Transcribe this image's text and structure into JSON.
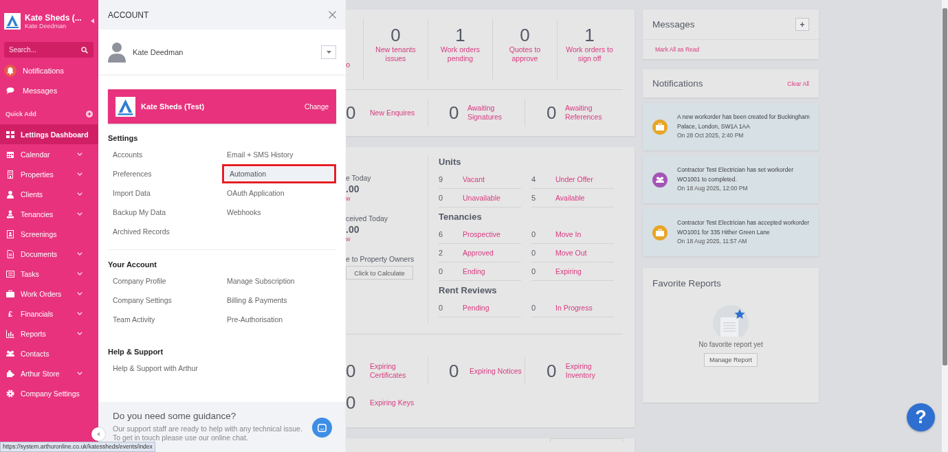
{
  "sidebar": {
    "company": "Kate Sheds (...",
    "user": "Kate Deedman",
    "search": {
      "placeholder": "Search..."
    },
    "top_items": [
      {
        "label": "Notifications",
        "kind": "bell"
      },
      {
        "label": "Messages",
        "kind": "chat"
      }
    ],
    "quick_add": "Quick Add",
    "nav": [
      {
        "label": "Lettings Dashboard",
        "kind": "grid",
        "expandable": false,
        "selected": true
      },
      {
        "label": "Calendar",
        "kind": "calendar",
        "expandable": true,
        "selected": false
      },
      {
        "label": "Properties",
        "kind": "building",
        "expandable": true,
        "selected": false
      },
      {
        "label": "Clients",
        "kind": "person",
        "expandable": true,
        "selected": false
      },
      {
        "label": "Tenancies",
        "kind": "tenancy",
        "expandable": true,
        "selected": false
      },
      {
        "label": "Screenings",
        "kind": "idcard",
        "expandable": false,
        "selected": false
      },
      {
        "label": "Documents",
        "kind": "document",
        "expandable": true,
        "selected": false
      },
      {
        "label": "Tasks",
        "kind": "list",
        "expandable": true,
        "selected": false
      },
      {
        "label": "Work Orders",
        "kind": "briefcase",
        "expandable": true,
        "selected": false
      },
      {
        "label": "Financials",
        "kind": "glyph",
        "glyph": "£",
        "expandable": true,
        "selected": false
      },
      {
        "label": "Reports",
        "kind": "chart",
        "expandable": true,
        "selected": false
      },
      {
        "label": "Contacts",
        "kind": "people",
        "expandable": false,
        "selected": false
      },
      {
        "label": "Arthur Store",
        "kind": "puzzle",
        "expandable": true,
        "selected": false
      },
      {
        "label": "Company Settings",
        "kind": "gear",
        "expandable": false,
        "selected": false
      }
    ]
  },
  "account_panel": {
    "title": "ACCOUNT",
    "user": "Kate Deedman",
    "company": {
      "name": "Kate Sheds (Test)",
      "action": "Change"
    },
    "sections": [
      {
        "heading": "Settings",
        "links": [
          {
            "label": "Accounts",
            "selected": false
          },
          {
            "label": "Email + SMS History",
            "selected": false
          },
          {
            "label": "Preferences",
            "selected": false
          },
          {
            "label": "Automation",
            "selected": true
          },
          {
            "label": "Import Data",
            "selected": false
          },
          {
            "label": "OAuth Application",
            "selected": false
          },
          {
            "label": "Backup My Data",
            "selected": false
          },
          {
            "label": "Webhooks",
            "selected": false
          },
          {
            "label": "Archived Records",
            "selected": false
          }
        ]
      },
      {
        "heading": "Your Account",
        "links": [
          {
            "label": "Company Profile",
            "selected": false
          },
          {
            "label": "Manage Subscription",
            "selected": false
          },
          {
            "label": "Company Settings",
            "selected": false
          },
          {
            "label": "Billing & Payments",
            "selected": false
          },
          {
            "label": "Team Activity",
            "selected": false
          },
          {
            "label": "Pre-Authorisation",
            "selected": false
          }
        ]
      },
      {
        "heading": "Help & Support",
        "links": [
          {
            "label": "Help & Support with Arthur",
            "selected": false
          }
        ]
      }
    ],
    "guidance": {
      "title": "Do you need some guidance?",
      "text": "Our support staff are ready to help with any technical issue. To get in touch please use our online chat."
    }
  },
  "dashboard": {
    "summary": {
      "fragment": "o",
      "stats": [
        {
          "value": "0",
          "label": "New tenants issues"
        },
        {
          "value": "1",
          "label": "Work orders pending"
        },
        {
          "value": "0",
          "label": "Quotes to approve"
        },
        {
          "value": "1",
          "label": "Work orders to sign off"
        }
      ],
      "row_2": [
        {
          "value": "0",
          "label": "New Enquires"
        },
        {
          "value": "0",
          "label": "Awaiting Signatures"
        },
        {
          "value": "0",
          "label": "Awaiting References"
        }
      ]
    },
    "finance": {
      "fragments": [
        {
          "kind": "caption",
          "text": "e Today"
        },
        {
          "kind": "amount",
          "text": ".00"
        },
        {
          "kind": "link",
          "text": "w"
        },
        {
          "kind": "caption",
          "text": "ceived Today"
        },
        {
          "kind": "amount",
          "text": ".00"
        },
        {
          "kind": "link",
          "text": "w"
        },
        {
          "kind": "caption",
          "text": "e to Property Owners"
        }
      ],
      "button": "Click to Calculate"
    },
    "groups": [
      {
        "title": "Units",
        "items": [
          {
            "value": "9",
            "label": "Vacant"
          },
          {
            "value": "4",
            "label": "Under Offer"
          },
          {
            "value": "0",
            "label": "Unavailable"
          },
          {
            "value": "5",
            "label": "Available"
          }
        ]
      },
      {
        "title": "Tenancies",
        "items": [
          {
            "value": "6",
            "label": "Prospective"
          },
          {
            "value": "0",
            "label": "Move In"
          },
          {
            "value": "2",
            "label": "Approved"
          },
          {
            "value": "0",
            "label": "Move Out"
          },
          {
            "value": "0",
            "label": "Ending"
          },
          {
            "value": "0",
            "label": "Expiring"
          }
        ]
      },
      {
        "title": "Rent Reviews",
        "items": [
          {
            "value": "0",
            "label": "Pending"
          },
          {
            "value": "0",
            "label": "In Progress"
          }
        ]
      }
    ],
    "expiring": [
      {
        "value": "0",
        "label": "Expiring Certificates"
      },
      {
        "value": "0",
        "label": "Expiring Notices"
      },
      {
        "value": "0",
        "label": "Expiring Inventory"
      }
    ],
    "expiring_2": [
      {
        "value": "0",
        "label": "Expiring Keys"
      }
    ]
  },
  "messages": {
    "title": "Messages",
    "add": "+",
    "mark_all": "Mark All as Read"
  },
  "notifications": {
    "title": "Notifications",
    "clear": "Clear All",
    "items": [
      {
        "kind": "briefcase",
        "color": "#e8a526",
        "text": "A new workorder has been created for Buckingham Palace, London, SW1A 1AA",
        "time": "On 28 Oct 2025, 2:40 PM"
      },
      {
        "kind": "people",
        "color": "#a455b6",
        "text": "Contractor Test Electrician has set workorder WO1001 to completed.",
        "time": "On 18 Aug 2025, 12:00 PM"
      },
      {
        "kind": "briefcase",
        "color": "#e8a526",
        "text": "Contractor Test Electrician has accepted workorder WO1001 for 335 Hither Green Lane",
        "time": "On 18 Aug 2025, 11:57 AM"
      }
    ]
  },
  "favorite_reports": {
    "title": "Favorite Reports",
    "empty": "No favorite report yet",
    "button": "Manage Report"
  },
  "help_button": "?",
  "status_bar": "https://system.arthuronline.co.uk/katessheds/events/index"
}
